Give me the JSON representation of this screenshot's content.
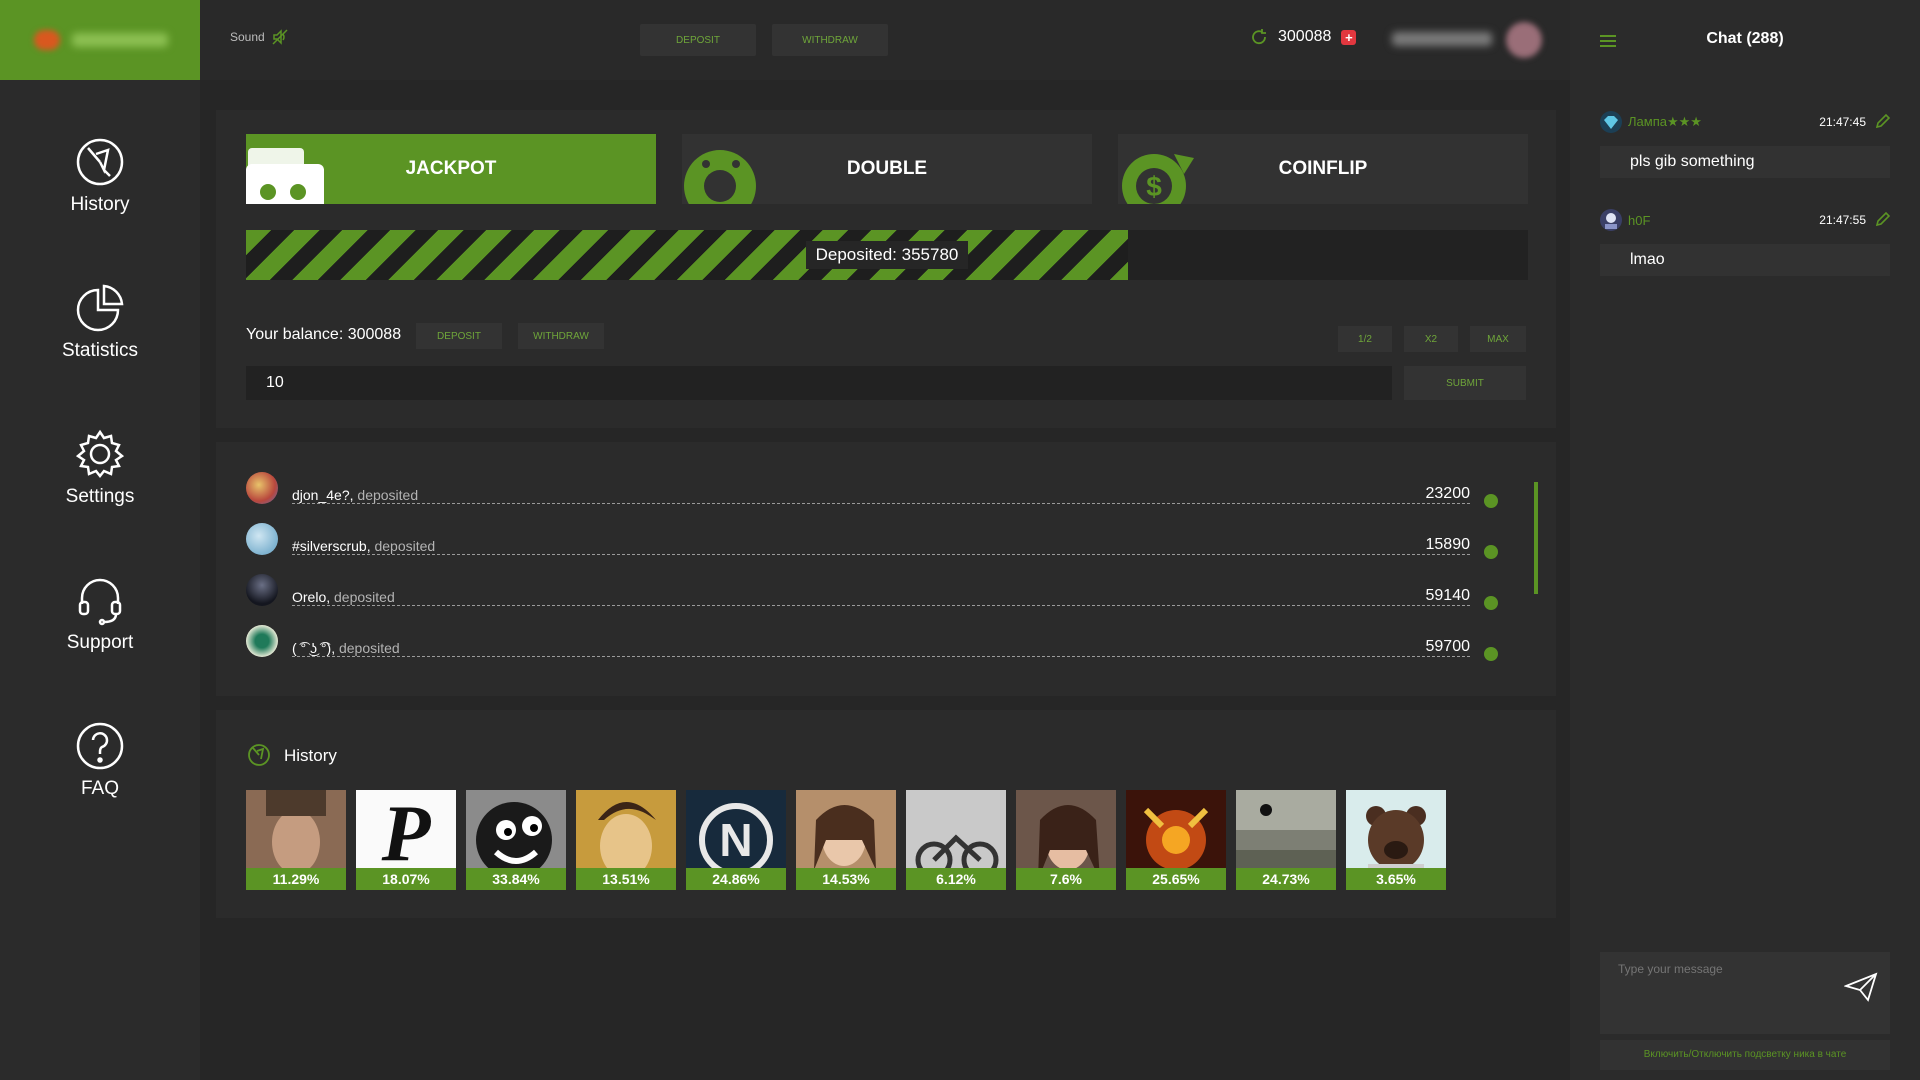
{
  "sidebar": {
    "items": [
      {
        "label": "History",
        "icon": "history-icon"
      },
      {
        "label": "Statistics",
        "icon": "pie-chart-icon"
      },
      {
        "label": "Settings",
        "icon": "gear-icon"
      },
      {
        "label": "Support",
        "icon": "headset-icon"
      },
      {
        "label": "FAQ",
        "icon": "question-icon"
      }
    ]
  },
  "topbar": {
    "sound_label": "Sound",
    "deposit_label": "DEPOSIT",
    "withdraw_label": "WITHDRAW",
    "balance": "300088"
  },
  "games": {
    "tabs": [
      {
        "label": "JACKPOT",
        "active": true
      },
      {
        "label": "DOUBLE",
        "active": false
      },
      {
        "label": "COINFLIP",
        "active": false
      }
    ]
  },
  "jackpot": {
    "deposited_text": "Deposited: 355780",
    "progress_fraction": 0.688,
    "balance_text": "Your balance: 300088",
    "deposit_label": "DEPOSIT",
    "withdraw_label": "WITHDRAW",
    "half_label": "1/2",
    "double_label": "x2",
    "max_label": "MAX",
    "bet_value": "10",
    "submit_label": "SUBMIT"
  },
  "deposits": [
    {
      "name": "djon_4e?,",
      "verb": "deposited",
      "amount": "23200"
    },
    {
      "name": "#silverscrub,",
      "verb": "deposited",
      "amount": "15890"
    },
    {
      "name": "Orelo,",
      "verb": "deposited",
      "amount": "59140"
    },
    {
      "name": "( ͡° ͜ʖ ͡°),",
      "verb": "deposited",
      "amount": "59700"
    }
  ],
  "history": {
    "title": "History",
    "items": [
      "11.29%",
      "18.07%",
      "33.84%",
      "13.51%",
      "24.86%",
      "14.53%",
      "6.12%",
      "7.6%",
      "25.65%",
      "24.73%",
      "3.65%"
    ]
  },
  "chat": {
    "title": "Chat (288)",
    "messages": [
      {
        "name": "Лампа★★★",
        "time": "21:47:45",
        "text": "pls gib something"
      },
      {
        "name": "h0F",
        "time": "21:47:55",
        "text": "lmao"
      }
    ],
    "input_placeholder": "Type your message",
    "footer": "Включить/Отключить подсветку ника в чате"
  },
  "colors": {
    "accent": "#5b9424",
    "background": "#262626",
    "panel": "#2b2b2b"
  }
}
